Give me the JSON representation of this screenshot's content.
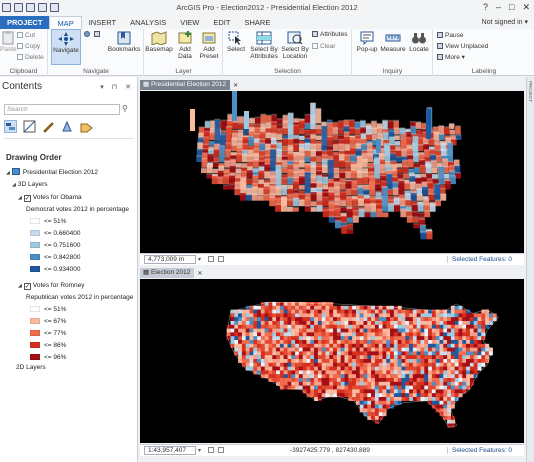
{
  "app": {
    "title": "ArcGIS Pro - Election2012 - Presidential Election 2012",
    "user": "Not signed in ▾",
    "window_controls": [
      "?",
      "–",
      "□",
      "✕"
    ]
  },
  "tabs": [
    "PROJECT",
    "MAP",
    "INSERT",
    "ANALYSIS",
    "VIEW",
    "EDIT",
    "SHARE"
  ],
  "active_tab": "MAP",
  "ribbon": {
    "clipboard": {
      "paste": "Paste",
      "cut": "Cut",
      "copy": "Copy",
      "delete": "Delete",
      "label": "Clipboard"
    },
    "navigate": {
      "navigate": "Navigate",
      "bookmarks": "Bookmarks",
      "label": "Navigate"
    },
    "layer": {
      "basemap": "Basemap",
      "add_data": "Add Data",
      "add_preset": "Add Preset",
      "label": "Layer"
    },
    "selection": {
      "select": "Select",
      "by_attributes": "Select By Attributes",
      "by_location": "Select By Location",
      "attributes": "Attributes",
      "clear": "Clear",
      "label": "Selection"
    },
    "inquiry": {
      "popup": "Pop-up",
      "measure": "Measure",
      "locate": "Locate",
      "label": "Inquiry"
    },
    "labeling": {
      "pause": "Pause",
      "view_unplaced": "View Unplaced",
      "more": "More ▾",
      "label": "Labeling"
    }
  },
  "contents": {
    "title": "Contents",
    "pin": "▾ ⊓ ✕",
    "search_placeholder": "Search",
    "drawing_order": "Drawing Order",
    "map_name": "Presidential Election 2012",
    "group_3d": "3D Layers",
    "group_2d": "2D Layers",
    "obama": {
      "name": "Votes for Obama",
      "field": "Democrat votes 2012 in percentage",
      "classes": [
        {
          "label": "<= 51%",
          "color": "#ffffff"
        },
        {
          "label": "<= 0.660400",
          "color": "#c6dbef"
        },
        {
          "label": "<= 0.751600",
          "color": "#9ecae1"
        },
        {
          "label": "<= 0.842800",
          "color": "#4a90c6"
        },
        {
          "label": "<= 0.934000",
          "color": "#1f5aa0"
        }
      ]
    },
    "romney": {
      "name": "Votes for Romney",
      "field": "Republican votes 2012 in percentage",
      "classes": [
        {
          "label": "<= 51%",
          "color": "#ffffff"
        },
        {
          "label": "<= 67%",
          "color": "#fcbba1"
        },
        {
          "label": "<= 77%",
          "color": "#f26d4f"
        },
        {
          "label": "<= 86%",
          "color": "#d7301f"
        },
        {
          "label": "<= 96%",
          "color": "#a50f15"
        }
      ]
    }
  },
  "views": {
    "top": {
      "tab": "Presidential Election 2012",
      "scale": "4,773,009 m",
      "selected": "Selected Features: 0"
    },
    "bottom": {
      "tab": "Election 2012",
      "scale": "1:43,957,407",
      "coords": "-3927425.779 , 827430.889",
      "selected": "Selected Features: 0"
    }
  },
  "side_strip": "PROJECT",
  "colors": {
    "project_tab": "#2b6dbf",
    "map_background": "#000000",
    "democrat": "#3d7fc1",
    "republican": "#d7301f"
  }
}
